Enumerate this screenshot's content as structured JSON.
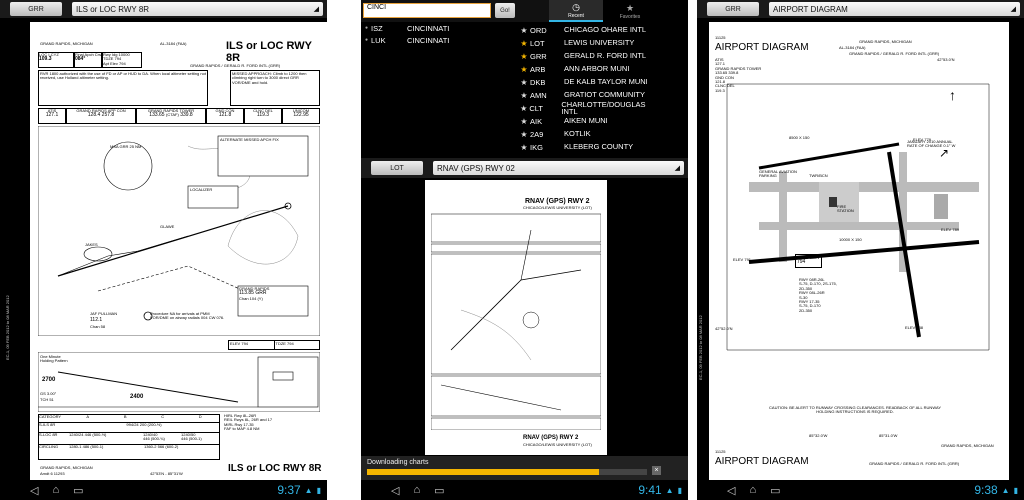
{
  "screen1": {
    "code_btn": "GRR",
    "chart_title": "ILS or LOC RWY 8R",
    "plate": {
      "city": "GRAND RAPIDS, MICHIGAN",
      "al_number": "AL-3184 (FAA)",
      "title": "ILS or LOC RWY 8R",
      "airport": "GRAND RAPIDS / GERALD R. FORD INTL (GRR)",
      "loc_ident": "LOC I-CYZ",
      "loc_freq": "109.3",
      "course_label": "Final Apch Crs",
      "course": "084°",
      "rwy_idg": "Rwy Idg 10000",
      "tdze": "TDZE 794",
      "apt_elev": "Apt Elev 794",
      "atis": "ATIS",
      "atis_freq": "127.1",
      "app_con": "GRAND RAPIDS APP CON",
      "app_con_freq": "128.4  257.8",
      "tower": "GRAND RAPIDS TOWER",
      "tower_freq": "133.65",
      "ctaf": "(CTAF)",
      "tower_uhf": "339.8",
      "gnd_con": "GND CON",
      "gnd_con_freq": "121.8",
      "clnc_del": "CLNC DEL",
      "clnc_del_freq": "119.3",
      "unicom": "UNICOM",
      "unicom_freq": "122.95",
      "missed_apch": "MISSED APPROACH: Climb to 1200 then climbing right turn to 3000 direct GRR VOR/DME and hold.",
      "notes": "RVR 1800 authorized with the use of FD or AP or HUD to DA. When local altimeter setting not received, use Holland altimeter setting.",
      "alt_missed": "ALTERNATE MISSED APCH FIX",
      "msa": "MSA GRR 25 NM",
      "localizer": "LOCALIZER",
      "gr_vor": "GRAND RAPIDS",
      "gr_vor_freq": "113.85",
      "gr_vor_id": "GRR",
      "gr_vor_ch": "Chan 104 (Y)",
      "elev": "ELEV 794",
      "tdze_box": "TDZE 794",
      "jakes": "JAKES",
      "glawe": "GLAWE",
      "procedure_na": "Procedure NA for arrivals at PMM VOR/DME on airway radials 004 CW 076.",
      "jaf": "JAF PULLMAN",
      "jaf_freq": "112.1",
      "jaf_ch": "Chan 58",
      "one_min": "One Minute Holding Pattern",
      "alt1": "2700",
      "alt2": "2400",
      "gs_angle": "GS 3.00°",
      "tch": "TCH 51",
      "category": "CATEGORY",
      "cats": [
        "A",
        "B",
        "C",
        "D"
      ],
      "s_ils": "S-ILS 8R",
      "s_ils_min": "994/24  200 (200-½)",
      "s_loc": "S-LOC 8R",
      "s_loc_min": [
        "1240/24",
        "446 (500-½)",
        "1240/40",
        "446 (500-¾)",
        "1240/50",
        "446 (500-1)"
      ],
      "circling": "CIRCLING",
      "circling_min": [
        "1280-1",
        "486 (500-1)",
        "1360-2",
        "566 (600-2)"
      ],
      "hirl": "HIRL Rwy 8L-26R",
      "reil": "REIL Rwys 8L, 26R and 17",
      "mirl": "MIRL Rwy 17-35",
      "faf": "FAF to MAP 4.8 NM",
      "footer_city": "GRAND RAPIDS, MICHIGAN",
      "footer_amdt": "Amdt 6 11293",
      "footer_coord": "42°53'N - 85°31'W",
      "side_date": "EC-1, 09 FEB 2012 to 08 MAR 2012"
    },
    "time": "9:37"
  },
  "screen2": {
    "search_value": "CINCI",
    "go_label": "Go!",
    "tab_recent": "Recent",
    "tab_favorites": "Favorites",
    "results": [
      {
        "code": "ISZ",
        "name": "CINCINNATI"
      },
      {
        "code": "LUK",
        "name": "CINCINNATI"
      }
    ],
    "favorites": [
      {
        "code": "ORD",
        "name": "CHICAGO OHARE INTL",
        "starred": false
      },
      {
        "code": "LOT",
        "name": "LEWIS UNIVERSITY",
        "starred": true
      },
      {
        "code": "GRR",
        "name": "GERALD R. FORD INTL",
        "starred": true
      },
      {
        "code": "ARB",
        "name": "ANN ARBOR MUNI",
        "starred": true
      },
      {
        "code": "DKB",
        "name": "DE KALB TAYLOR MUNI",
        "starred": false
      },
      {
        "code": "AMN",
        "name": "GRATIOT COMMUNITY",
        "starred": false
      },
      {
        "code": "CLT",
        "name": "CHARLOTTE/DOUGLAS INTL",
        "starred": false
      },
      {
        "code": "AIK",
        "name": "AIKEN MUNI",
        "starred": false
      },
      {
        "code": "2A9",
        "name": "KOTLIK",
        "starred": false
      },
      {
        "code": "IKG",
        "name": "KLEBERG COUNTY",
        "starred": false
      }
    ],
    "code_btn": "LOT",
    "chart_title": "RNAV (GPS) RWY 02",
    "plate": {
      "title": "RNAV (GPS) RWY 2",
      "airport": "CHICAGO/LEWIS UNIVERSITY (LOT)",
      "footer_title": "RNAV (GPS) RWY 2",
      "footer_airport": "CHICAGO/LEWIS UNIVERSITY (LOT)"
    },
    "progress_label": "Downloading charts",
    "progress_fraction": 0.83,
    "close_label": "×",
    "time": "9:41"
  },
  "screen3": {
    "code_btn": "GRR",
    "chart_title": "AIRPORT DIAGRAM",
    "plate": {
      "number": "11125",
      "title": "AIRPORT DIAGRAM",
      "al_number": "AL-3184 (FAA)",
      "airport": "GRAND RAPIDS / GERALD R. FORD INTL (GRR)",
      "city": "GRAND RAPIDS, MICHIGAN",
      "atis": "ATIS",
      "atis_freq": "127.1",
      "tower": "GRAND RAPIDS TOWER",
      "tower_freq": "133.65 339.8",
      "gnd_con": "GND CON",
      "gnd_con_freq": "121.8",
      "clnc_del": "CLNC DEL",
      "clnc_del_freq": "119.3",
      "lat_top": "42°53.0'N",
      "lat_bottom": "42°52.0'N",
      "var": "JANUARY 2010 ANNUAL RATE OF CHANGE 0.1° W",
      "ga_parking": "GENERAL AVIATION PARKING",
      "twr": "TWR/BCN",
      "fire": "FIRE STATION",
      "rwy1": "10000 X 150",
      "rwy2": "8500 X 150",
      "field_elev": "FIELD ELEV",
      "field_elev_val": "794",
      "elev_a": "ELEV 791",
      "elev_b": "ELEV 789",
      "elev_c": "ELEV 779",
      "elev_d": "ELEV 788",
      "rwy_info": "RWY 08R-26L\nS-75, D-170, 2S-175,\n2D-350\nRWY 08L-26R\nS-30\nRWY 17-35\nS-75, D-170\n2D-350",
      "caution": "CAUTION: BE ALERT TO RUNWAY CROSSING CLEARANCES. READBACK OF ALL RUNWAY HOLDING INSTRUCTIONS IS REQUIRED.",
      "lon_left": "85°32.0'W",
      "lon_right": "85°31.0'W",
      "footer_city": "GRAND RAPIDS, MICHIGAN",
      "footer_title": "AIRPORT DIAGRAM",
      "footer_airport": "GRAND RAPIDS / GERALD R. FORD INTL (GRR)",
      "footer_number": "11125",
      "side_date": "EC-1, 09 FEB 2012 to 08 MAR 2012"
    },
    "time": "9:38"
  },
  "nav": {
    "back_icon": "◁",
    "home_icon": "⌂",
    "recent_icon": "▭"
  },
  "colors": {
    "accent": "#33b5e5",
    "progress": "#f4b500",
    "star": "#f4b500"
  }
}
